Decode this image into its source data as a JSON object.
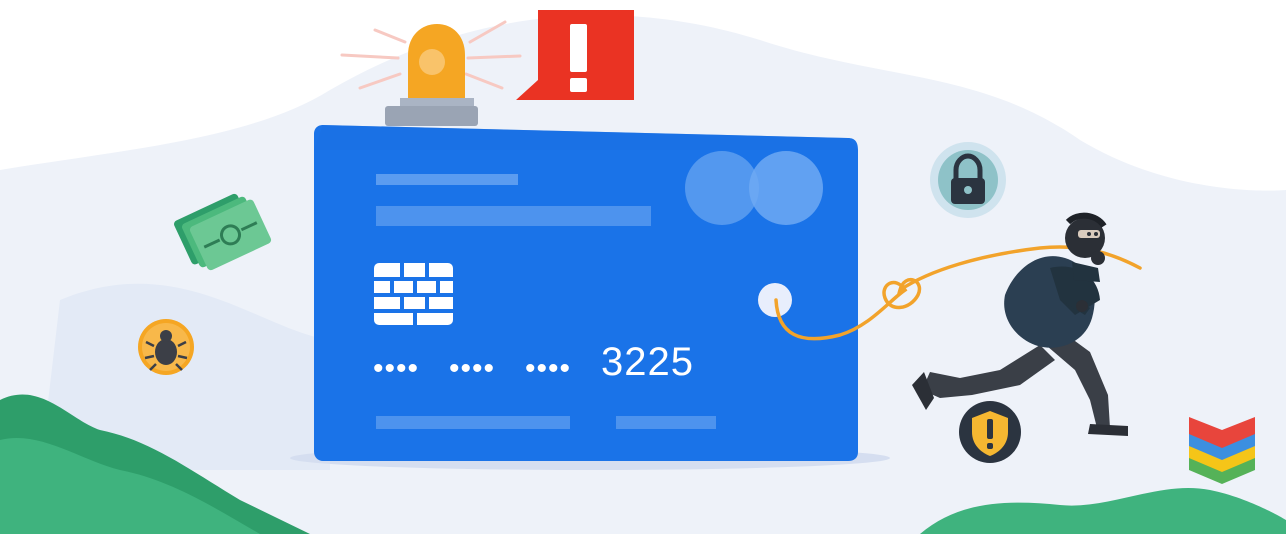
{
  "card": {
    "number_groups": [
      "••••",
      "••••",
      "••••"
    ],
    "last_digits": "3225"
  },
  "colors": {
    "card": "#1a73e8",
    "alert_red": "#ea3323",
    "siren_orange": "#f5a623",
    "rope": "#f2a32b",
    "hill_green": "#3fb37e",
    "background_blob": "#eef2f9"
  },
  "icons": [
    "alarm-siren-icon",
    "alert-exclamation-icon",
    "money-bills-icon",
    "bug-icon",
    "padlock-icon",
    "warning-shield-icon",
    "layers-logo-icon",
    "thief-figure",
    "rope"
  ]
}
